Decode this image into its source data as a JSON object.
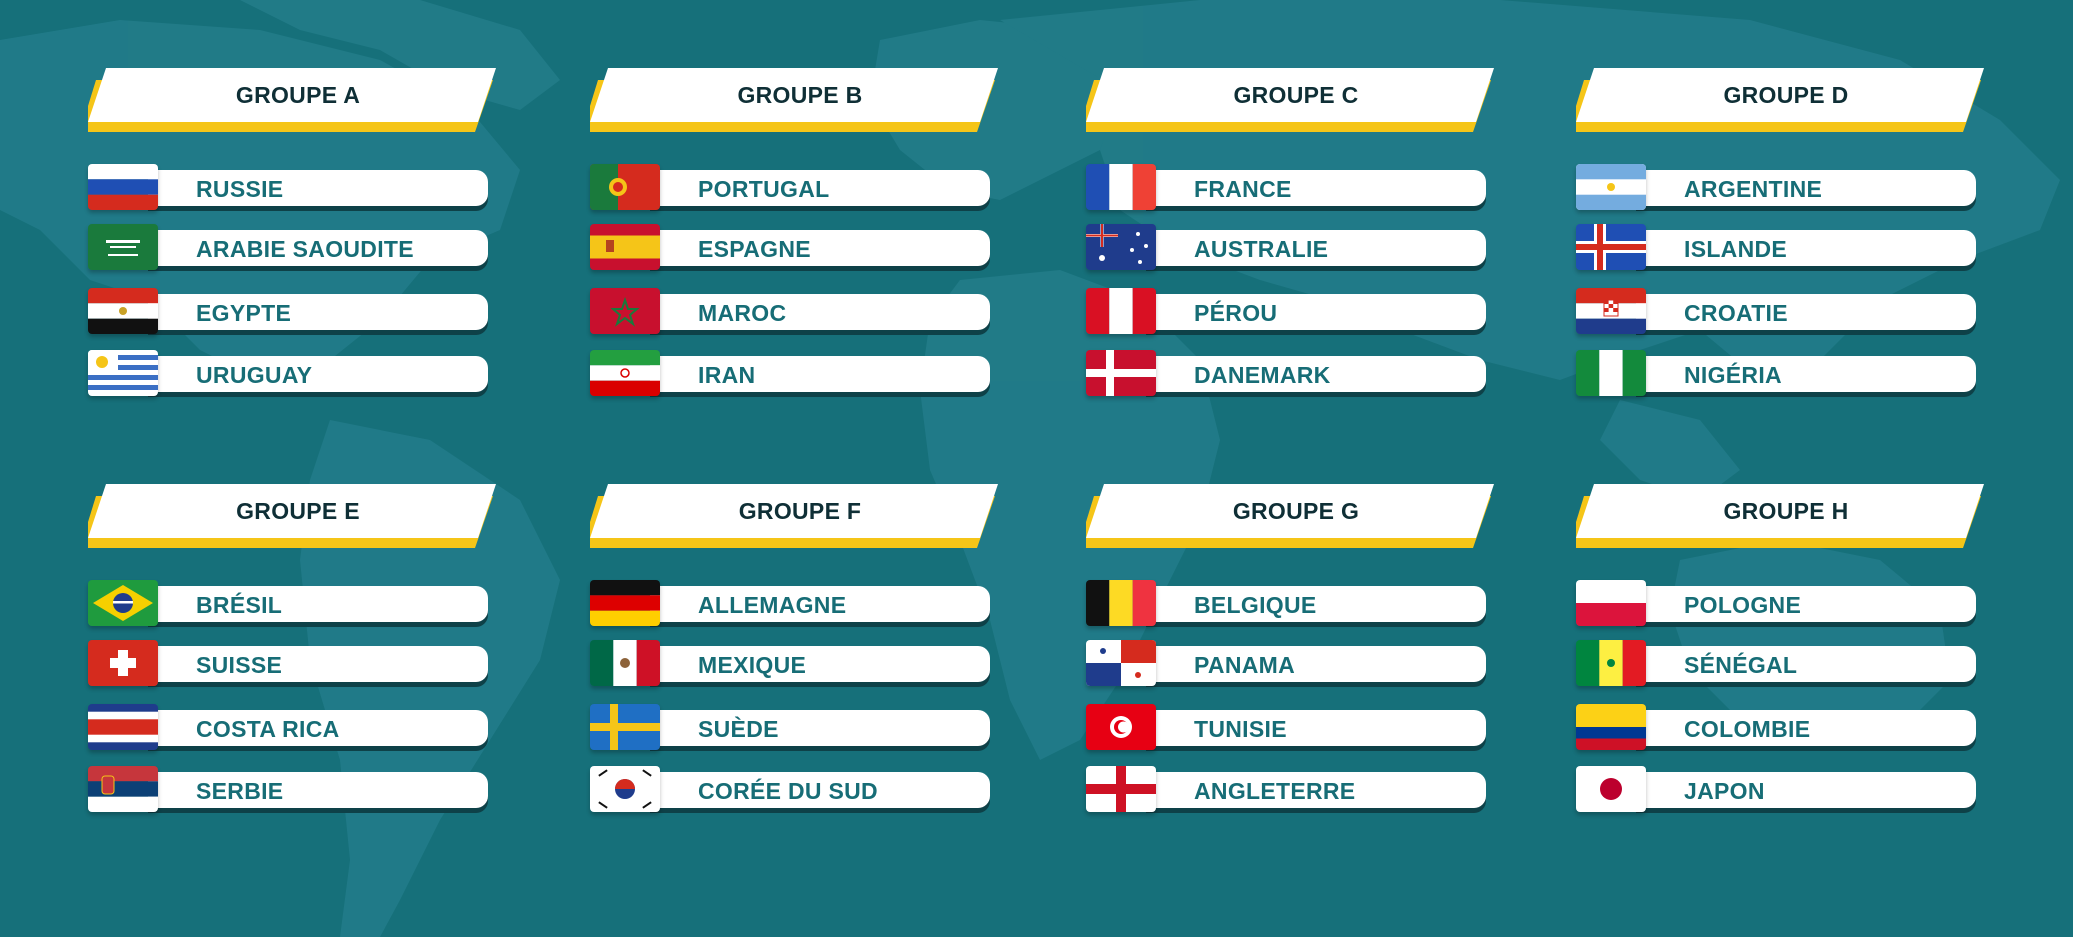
{
  "colors": {
    "background": "#16707a",
    "map_land": "#2a8493",
    "header_bg": "#ffffff",
    "header_accent": "#f5c518",
    "header_text": "#0f2f36",
    "team_text": "#176d76",
    "pill_shadow": "#0e4148"
  },
  "groups": [
    {
      "title": "GROUPE A",
      "teams": [
        {
          "name": "RUSSIE",
          "flag_icon": "flag-russia-icon"
        },
        {
          "name": "ARABIE SAOUDITE",
          "flag_icon": "flag-saudi-arabia-icon"
        },
        {
          "name": "EGYPTE",
          "flag_icon": "flag-egypt-icon"
        },
        {
          "name": "URUGUAY",
          "flag_icon": "flag-uruguay-icon"
        }
      ]
    },
    {
      "title": "GROUPE B",
      "teams": [
        {
          "name": "PORTUGAL",
          "flag_icon": "flag-portugal-icon"
        },
        {
          "name": "ESPAGNE",
          "flag_icon": "flag-spain-icon"
        },
        {
          "name": "MAROC",
          "flag_icon": "flag-morocco-icon"
        },
        {
          "name": "IRAN",
          "flag_icon": "flag-iran-icon"
        }
      ]
    },
    {
      "title": "GROUPE C",
      "teams": [
        {
          "name": "FRANCE",
          "flag_icon": "flag-france-icon"
        },
        {
          "name": "AUSTRALIE",
          "flag_icon": "flag-australia-icon"
        },
        {
          "name": "PÉROU",
          "flag_icon": "flag-peru-icon"
        },
        {
          "name": "DANEMARK",
          "flag_icon": "flag-denmark-icon"
        }
      ]
    },
    {
      "title": "GROUPE D",
      "teams": [
        {
          "name": "ARGENTINE",
          "flag_icon": "flag-argentina-icon"
        },
        {
          "name": "ISLANDE",
          "flag_icon": "flag-iceland-icon"
        },
        {
          "name": "CROATIE",
          "flag_icon": "flag-croatia-icon"
        },
        {
          "name": "NIGÉRIA",
          "flag_icon": "flag-nigeria-icon"
        }
      ]
    },
    {
      "title": "GROUPE E",
      "teams": [
        {
          "name": "BRÉSIL",
          "flag_icon": "flag-brazil-icon"
        },
        {
          "name": "SUISSE",
          "flag_icon": "flag-switzerland-icon"
        },
        {
          "name": "COSTA RICA",
          "flag_icon": "flag-costa-rica-icon"
        },
        {
          "name": "SERBIE",
          "flag_icon": "flag-serbia-icon"
        }
      ]
    },
    {
      "title": "GROUPE F",
      "teams": [
        {
          "name": "ALLEMAGNE",
          "flag_icon": "flag-germany-icon"
        },
        {
          "name": "MEXIQUE",
          "flag_icon": "flag-mexico-icon"
        },
        {
          "name": "SUÈDE",
          "flag_icon": "flag-sweden-icon"
        },
        {
          "name": "CORÉE DU SUD",
          "flag_icon": "flag-south-korea-icon"
        }
      ]
    },
    {
      "title": "GROUPE G",
      "teams": [
        {
          "name": "BELGIQUE",
          "flag_icon": "flag-belgium-icon"
        },
        {
          "name": "PANAMA",
          "flag_icon": "flag-panama-icon"
        },
        {
          "name": "TUNISIE",
          "flag_icon": "flag-tunisia-icon"
        },
        {
          "name": "ANGLETERRE",
          "flag_icon": "flag-england-icon"
        }
      ]
    },
    {
      "title": "GROUPE H",
      "teams": [
        {
          "name": "POLOGNE",
          "flag_icon": "flag-poland-icon"
        },
        {
          "name": "SÉNÉGAL",
          "flag_icon": "flag-senegal-icon"
        },
        {
          "name": "COLOMBIE",
          "flag_icon": "flag-colombia-icon"
        },
        {
          "name": "JAPON",
          "flag_icon": "flag-japan-icon"
        }
      ]
    }
  ]
}
